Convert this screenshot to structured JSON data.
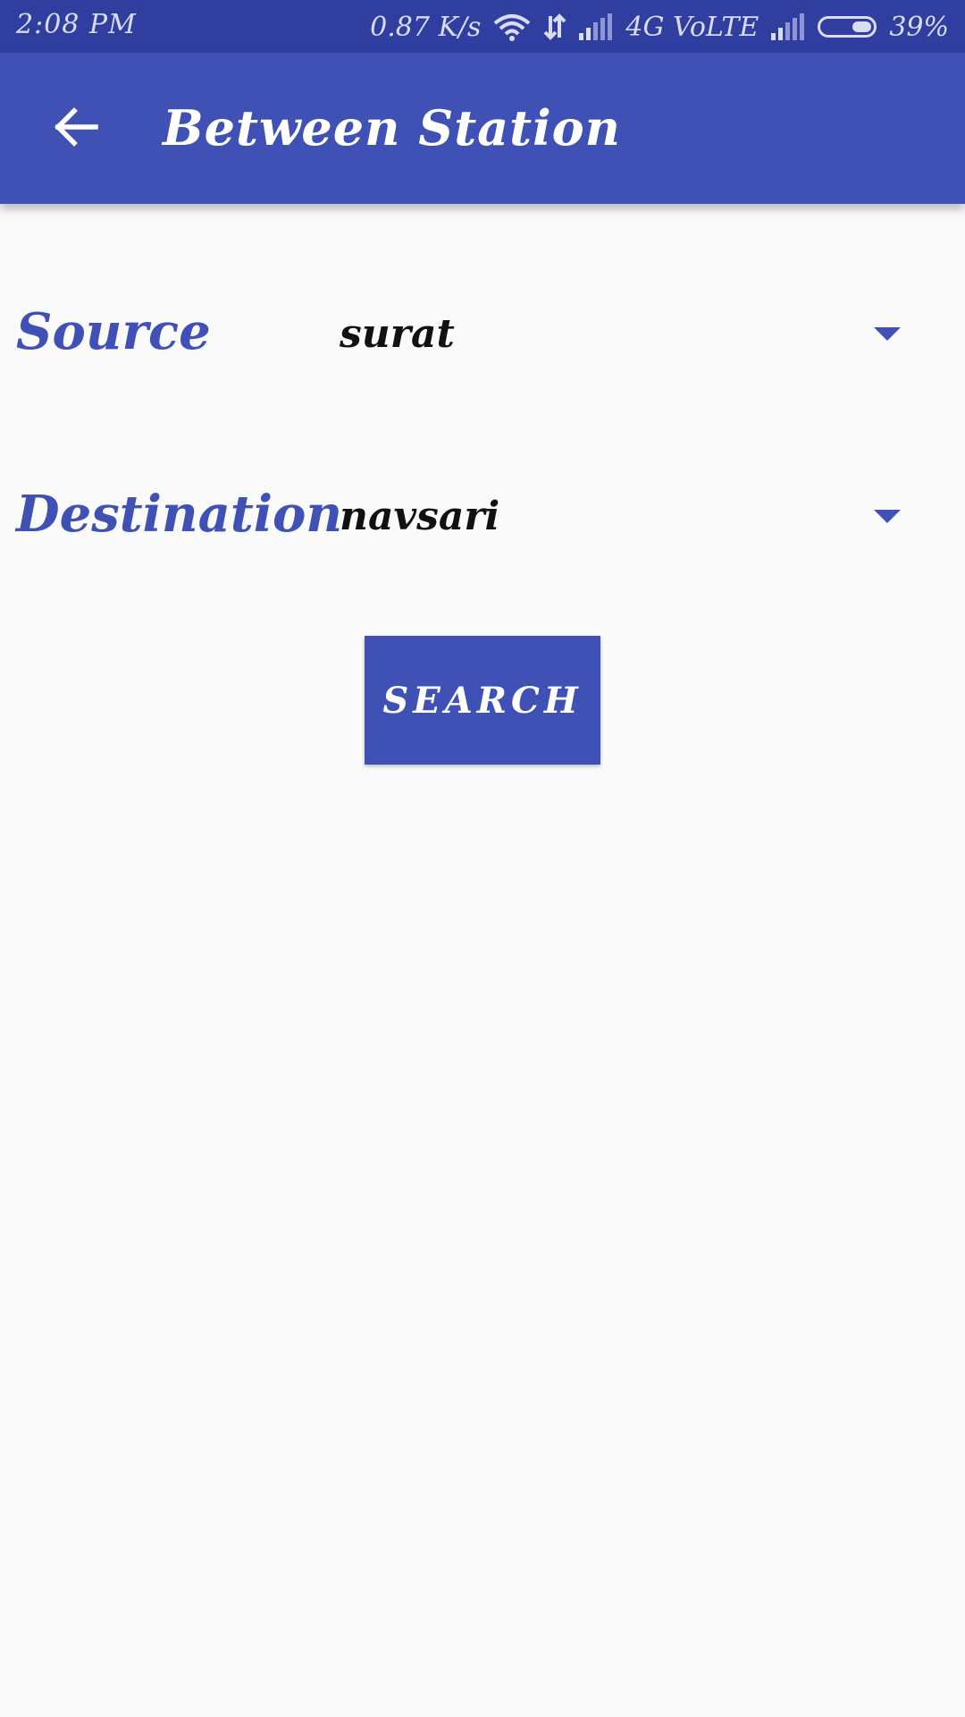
{
  "status_bar": {
    "time": "2:08 PM",
    "network_speed": "0.87 K/s",
    "network_type": "4G VoLTE",
    "battery_percent": "39%",
    "battery_level": 0.39,
    "icons": [
      "wifi-icon",
      "data-transfer-icon",
      "signal-icon",
      "battery-icon"
    ]
  },
  "app_bar": {
    "back_icon": "arrow-back-icon",
    "title": "Between Station"
  },
  "form": {
    "source": {
      "label": "Source",
      "value": "surat"
    },
    "destination": {
      "label": "Destination",
      "value": "navsari"
    },
    "search_label": "SEARCH"
  },
  "colors": {
    "primary": "#3f51b5",
    "primary_dark": "#303f9f",
    "background": "#fafafa",
    "value_text": "#111111"
  }
}
